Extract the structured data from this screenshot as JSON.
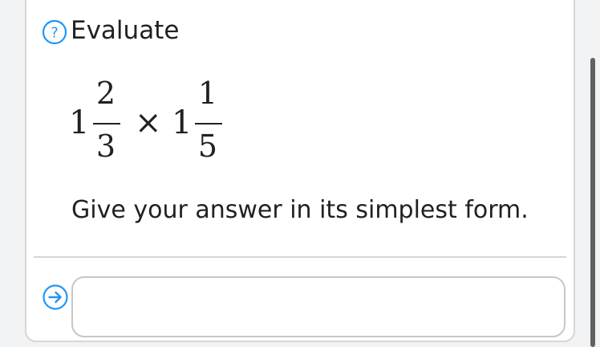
{
  "question": {
    "label": "Evaluate",
    "help_icon": "question-circle-icon",
    "expression": {
      "left_whole": "1",
      "left_numerator": "2",
      "left_denominator": "3",
      "operator": "×",
      "right_whole": "1",
      "right_numerator": "1",
      "right_denominator": "5"
    },
    "instruction": "Give your answer in its simplest form."
  },
  "answer": {
    "submit_icon": "arrow-right-circle-icon",
    "value": "",
    "placeholder": ""
  },
  "colors": {
    "accent": "#2196f3",
    "text": "#212121",
    "border": "#c7c7c7"
  }
}
